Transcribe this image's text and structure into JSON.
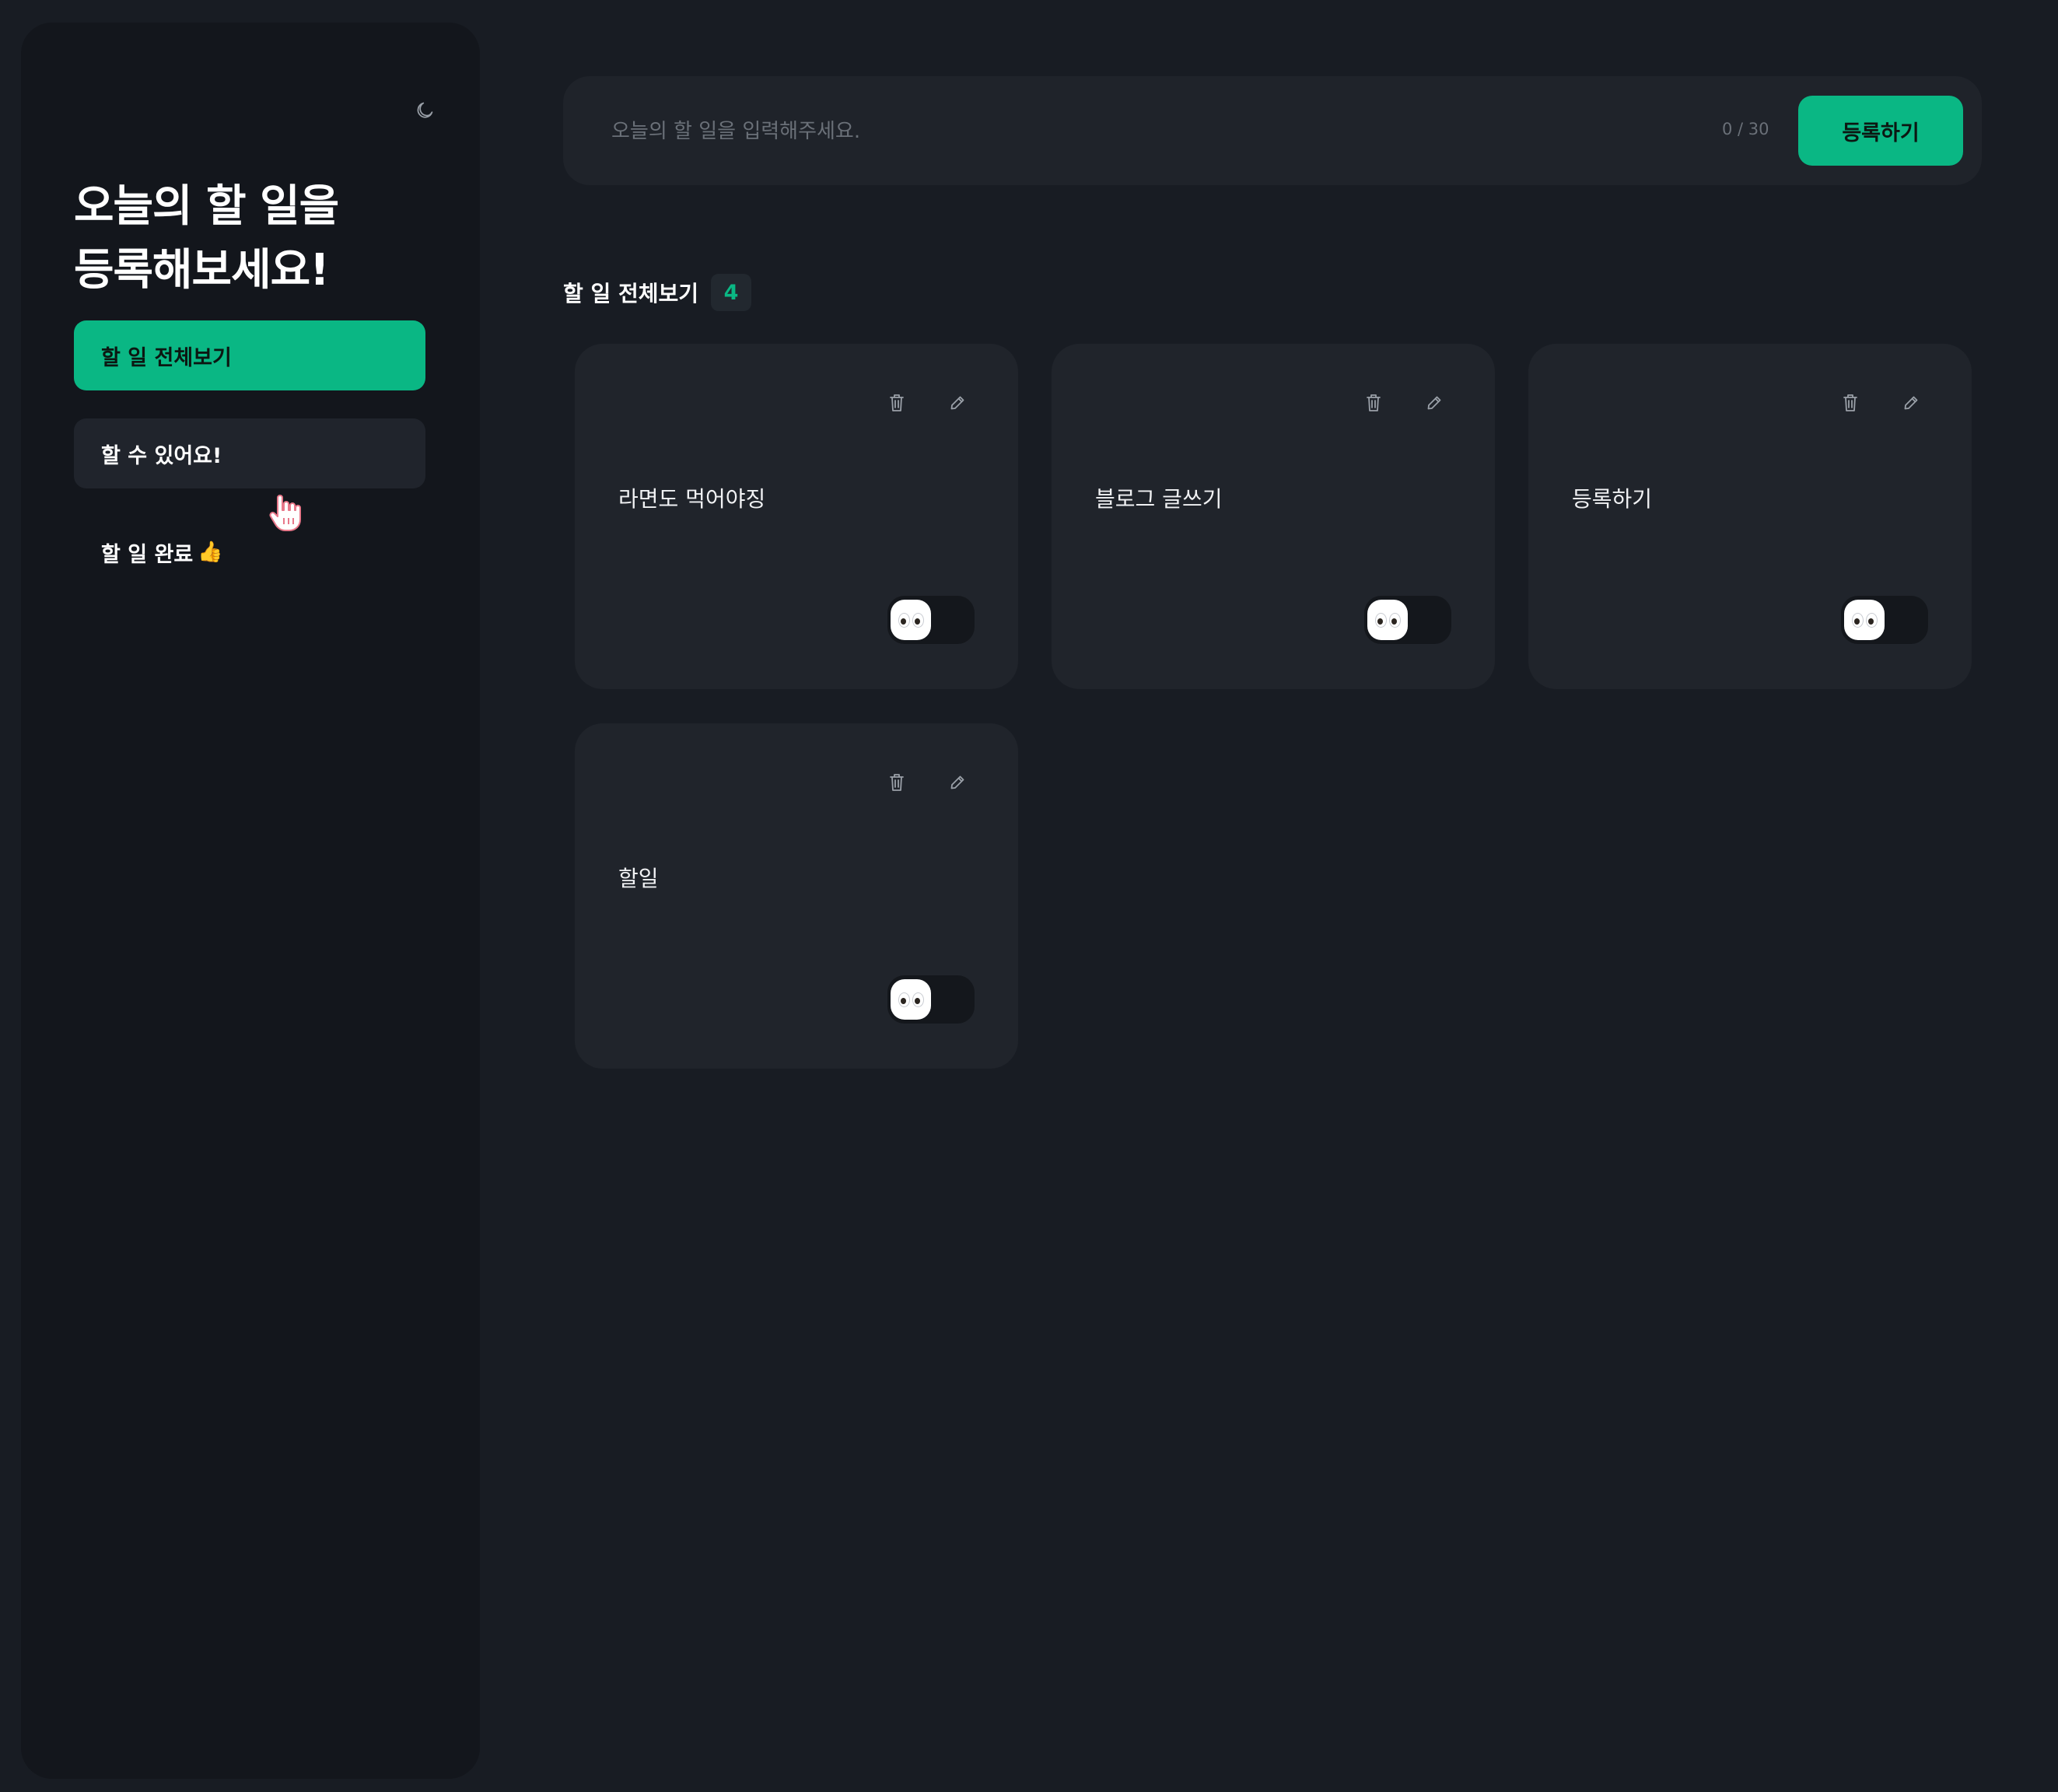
{
  "sidebar": {
    "title_line1": "오늘의 할 일을",
    "title_line2": "등록해보세요!",
    "theme_icon": "moon-icon",
    "nav": {
      "all": "할 일 전체보기",
      "can_do": "할 수 있어요!",
      "done": "할 일 완료",
      "done_emoji": "👍"
    }
  },
  "input": {
    "placeholder": "오늘의 할 일을 입력해주세요.",
    "value": "",
    "count": "0 / 30",
    "submit_label": "등록하기"
  },
  "section": {
    "title": "할 일 전체보기",
    "count": "4"
  },
  "todos": [
    {
      "text": "라면도 먹어야징",
      "completed": false
    },
    {
      "text": "블로그 글쓰기",
      "completed": false
    },
    {
      "text": "등록하기",
      "completed": false
    },
    {
      "text": "할일",
      "completed": false
    }
  ],
  "colors": {
    "accent": "#0ab784",
    "background": "#181c23",
    "sidebar": "#13161c",
    "card": "#20242b"
  },
  "icons": {
    "delete": "trash-icon",
    "edit": "pencil-icon",
    "toggle_knob": "eyes-icon",
    "cursor": "pointer-hand-icon"
  }
}
